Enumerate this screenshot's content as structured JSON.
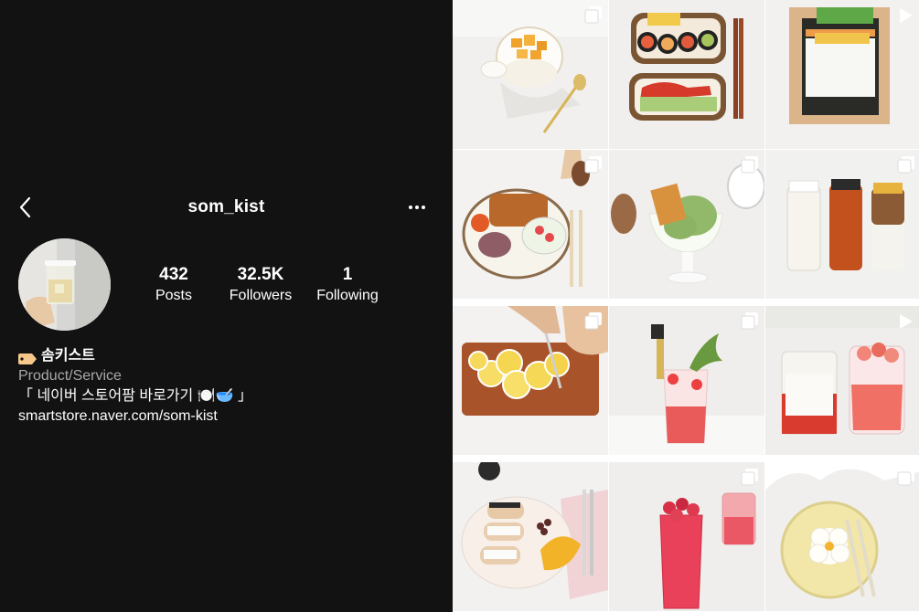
{
  "header": {
    "username": "som_kist"
  },
  "stats": [
    {
      "value": "432",
      "label": "Posts"
    },
    {
      "value": "32.5K",
      "label": "Followers"
    },
    {
      "value": "1",
      "label": "Following"
    }
  ],
  "bio": {
    "name": "솜키스트",
    "category": "Product/Service",
    "description": "「 네이버 스토어팜 바로가기 🍽️🥣 」",
    "link": "smartstore.naver.com/som-kist"
  },
  "colors": {
    "background": "#121212",
    "secondary_text": "#a8a8a8"
  },
  "posts": [
    {
      "subject": "peach yogurt",
      "icon": "carousel-icon"
    },
    {
      "subject": "kimbap bento",
      "icon": "none"
    },
    {
      "subject": "kimbap making",
      "icon": "reel-icon"
    },
    {
      "subject": "tonkatsu plate",
      "icon": "carousel-icon"
    },
    {
      "subject": "waffle ice cream",
      "icon": "carousel-icon"
    },
    {
      "subject": "bottled syrups",
      "icon": "carousel-icon"
    },
    {
      "subject": "lemon slicing",
      "icon": "carousel-icon"
    },
    {
      "subject": "strawberry ade",
      "icon": "carousel-icon"
    },
    {
      "subject": "jar strawberry drink",
      "icon": "reel-icon"
    },
    {
      "subject": "cannoli plate",
      "icon": "none"
    },
    {
      "subject": "raspberry drink",
      "icon": "carousel-icon"
    },
    {
      "subject": "flower cookie plate",
      "icon": "carousel-icon"
    }
  ]
}
